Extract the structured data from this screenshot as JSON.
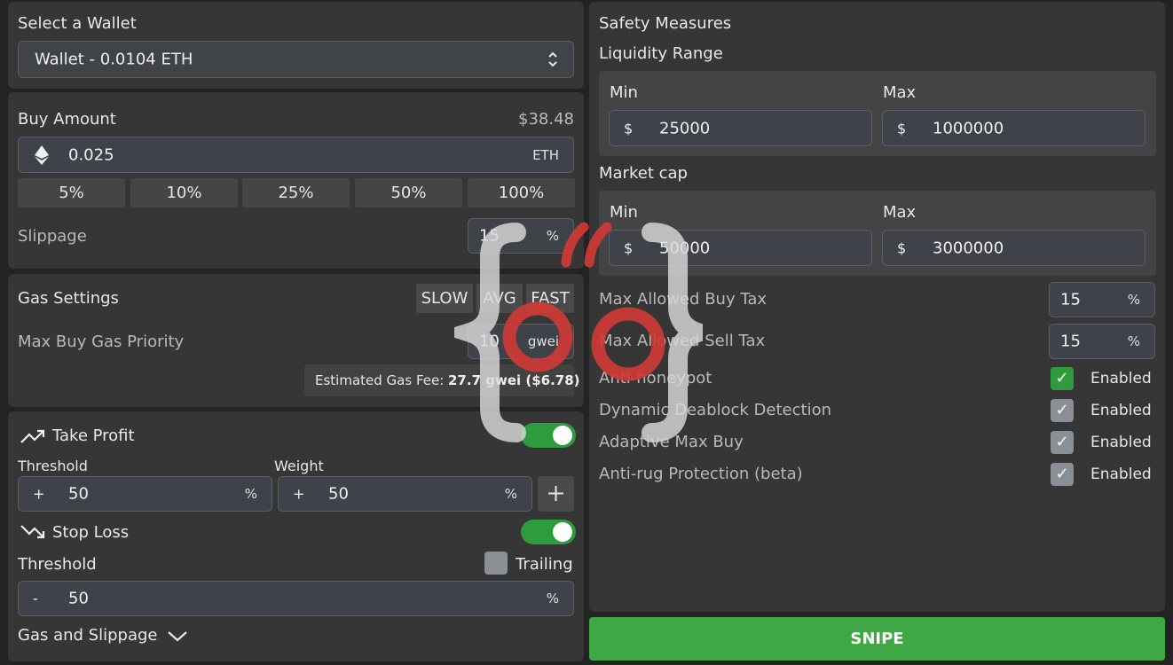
{
  "wallet": {
    "title": "Select a Wallet",
    "selected": "Wallet - 0.0104 ETH"
  },
  "buy": {
    "title": "Buy Amount",
    "usd_value": "$38.48",
    "amount": "0.025",
    "unit": "ETH",
    "percent_buttons": [
      "5%",
      "10%",
      "25%",
      "50%",
      "100%"
    ],
    "slippage_label": "Slippage",
    "slippage_value": "15",
    "slippage_unit": "%"
  },
  "gas": {
    "title": "Gas Settings",
    "presets": [
      "SLOW",
      "AVG",
      "FAST"
    ],
    "priority_label": "Max Buy Gas Priority",
    "priority_value": "10",
    "priority_unit": "gwei",
    "estimate_prefix": "Estimated Gas Fee: ",
    "estimate_value": "27.7 gwei ($6.78)"
  },
  "take_profit": {
    "title": "Take Profit",
    "enabled": true,
    "threshold_label": "Threshold",
    "threshold_sign": "+",
    "threshold_value": "50",
    "threshold_unit": "%",
    "weight_label": "Weight",
    "weight_sign": "+",
    "weight_value": "50",
    "weight_unit": "%",
    "add_symbol": "+"
  },
  "stop_loss": {
    "title": "Stop Loss",
    "enabled": true,
    "threshold_label": "Threshold",
    "trailing_label": "Trailing",
    "trailing_checked": false,
    "sign": "-",
    "value": "50",
    "unit": "%"
  },
  "gas_slippage_label": "Gas and Slippage",
  "safety": {
    "title": "Safety Measures",
    "liquidity": {
      "title": "Liquidity Range",
      "min_label": "Min",
      "max_label": "Max",
      "currency": "$",
      "min_value": "25000",
      "max_value": "1000000"
    },
    "market_cap": {
      "title": "Market cap",
      "min_label": "Min",
      "max_label": "Max",
      "currency": "$",
      "min_value": "50000",
      "max_value": "3000000"
    },
    "buy_tax_label": "Max Allowed Buy Tax",
    "buy_tax_value": "15",
    "sell_tax_label": "Max Allowed Sell Tax",
    "sell_tax_value": "15",
    "tax_unit": "%",
    "options": [
      {
        "label": "Anti-honeypot",
        "state": "Enabled",
        "checked": true
      },
      {
        "label": "Dynamic Deablock Detection",
        "state": "Enabled",
        "checked": true
      },
      {
        "label": "Adaptive Max Buy",
        "state": "Enabled",
        "checked": true
      },
      {
        "label": "Anti-rug Protection (beta)",
        "state": "Enabled",
        "checked": true
      }
    ]
  },
  "snipe_label": "SNIPE",
  "colors": {
    "accent_green": "#2e9b3d",
    "snipe_green": "#3fa845",
    "logo_red": "#d23a36",
    "logo_grey": "#cfcfcf"
  },
  "icons": [
    "ethereum-icon",
    "select-arrows-icon",
    "trend-up-icon",
    "trend-down-icon",
    "plus-icon",
    "chevron-down-icon",
    "check-icon",
    "logo-watermark"
  ]
}
